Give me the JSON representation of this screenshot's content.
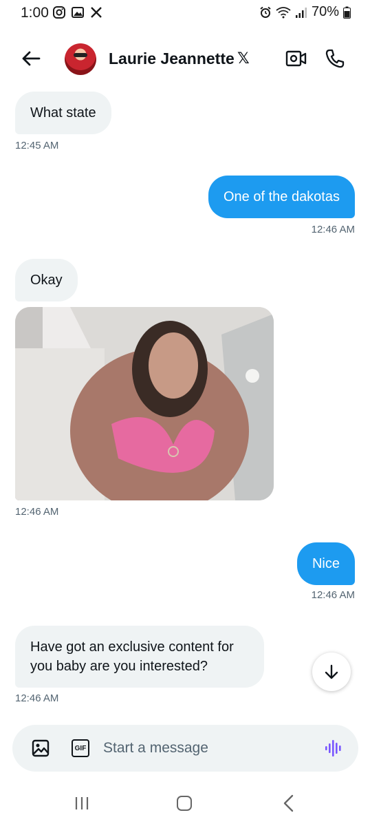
{
  "status_bar": {
    "time": "1:00",
    "battery": "70%",
    "left_icons": [
      "instagram-icon",
      "gallery-icon",
      "x-app-icon"
    ],
    "right_icons": [
      "alarm-icon",
      "wifi-icon",
      "signal-icon",
      "battery-icon"
    ]
  },
  "header": {
    "contact_name": "Laurie Jeannette",
    "badge": "𝕏",
    "icons": [
      "back-arrow-icon",
      "avatar",
      "video-call-icon",
      "phone-icon"
    ]
  },
  "messages": [
    {
      "direction": "received",
      "text": "What state",
      "time": "12:45 AM"
    },
    {
      "direction": "sent",
      "text": "One of the dakotas",
      "time": "12:46 AM"
    },
    {
      "direction": "received",
      "text": "Okay",
      "time": ""
    },
    {
      "direction": "received",
      "type": "image",
      "time": "12:46 AM"
    },
    {
      "direction": "sent",
      "text": "Nice",
      "time": "12:46 AM"
    },
    {
      "direction": "received",
      "text_line1": "Have got an exclusive content for",
      "text_line2": "you baby are you interested?",
      "time": "12:46 AM"
    }
  ],
  "composer": {
    "placeholder": "Start a message",
    "gif_label": "GIF",
    "icons": [
      "image-icon",
      "gif-icon",
      "voice-icon"
    ]
  },
  "scroll_button": {
    "icon": "arrow-down-icon"
  },
  "nav_bar": {
    "icons": [
      "recent-apps-icon",
      "home-icon",
      "back-icon"
    ]
  },
  "colors": {
    "sent_bubble": "#1d9bf0",
    "received_bubble": "#eff3f4",
    "timestamp": "#536471",
    "voice_accent": "#7856ff"
  }
}
